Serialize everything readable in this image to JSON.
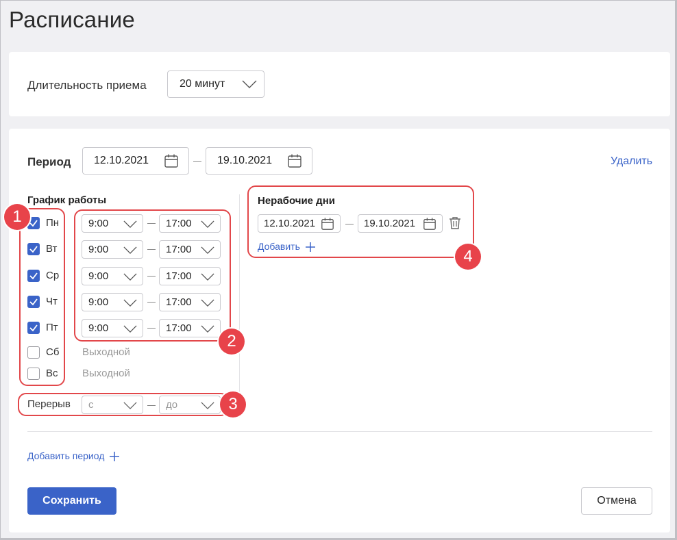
{
  "page": {
    "title": "Расписание"
  },
  "duration": {
    "label": "Длительность приема",
    "value": "20 минут"
  },
  "period": {
    "label": "Период",
    "from": "12.10.2021",
    "to": "19.10.2021",
    "delete_label": "Удалить"
  },
  "schedule": {
    "title": "График работы",
    "days": [
      {
        "label": "Пн",
        "checked": true,
        "from": "9:00",
        "to": "17:00"
      },
      {
        "label": "Вт",
        "checked": true,
        "from": "9:00",
        "to": "17:00"
      },
      {
        "label": "Ср",
        "checked": true,
        "from": "9:00",
        "to": "17:00"
      },
      {
        "label": "Чт",
        "checked": true,
        "from": "9:00",
        "to": "17:00"
      },
      {
        "label": "Пт",
        "checked": true,
        "from": "9:00",
        "to": "17:00"
      },
      {
        "label": "Сб",
        "checked": false,
        "dayoff": "Выходной"
      },
      {
        "label": "Вс",
        "checked": false,
        "dayoff": "Выходной"
      }
    ],
    "break": {
      "label": "Перерыв",
      "from_placeholder": "с",
      "to_placeholder": "до"
    }
  },
  "nonworking": {
    "title": "Нерабочие дни",
    "from": "12.10.2021",
    "to": "19.10.2021",
    "add_label": "Добавить"
  },
  "add_period_label": "Добавить период",
  "actions": {
    "save_label": "Сохранить",
    "cancel_label": "Отмена"
  },
  "annotations": [
    "1",
    "2",
    "3",
    "4"
  ],
  "colors": {
    "accent": "#3a63c8",
    "annotation": "#e8434a"
  },
  "icons": {
    "calendar": "calendar-icon",
    "chevron": "chevron-down-icon",
    "trash": "trash-icon",
    "plus": "plus-icon",
    "check": "check-icon"
  }
}
